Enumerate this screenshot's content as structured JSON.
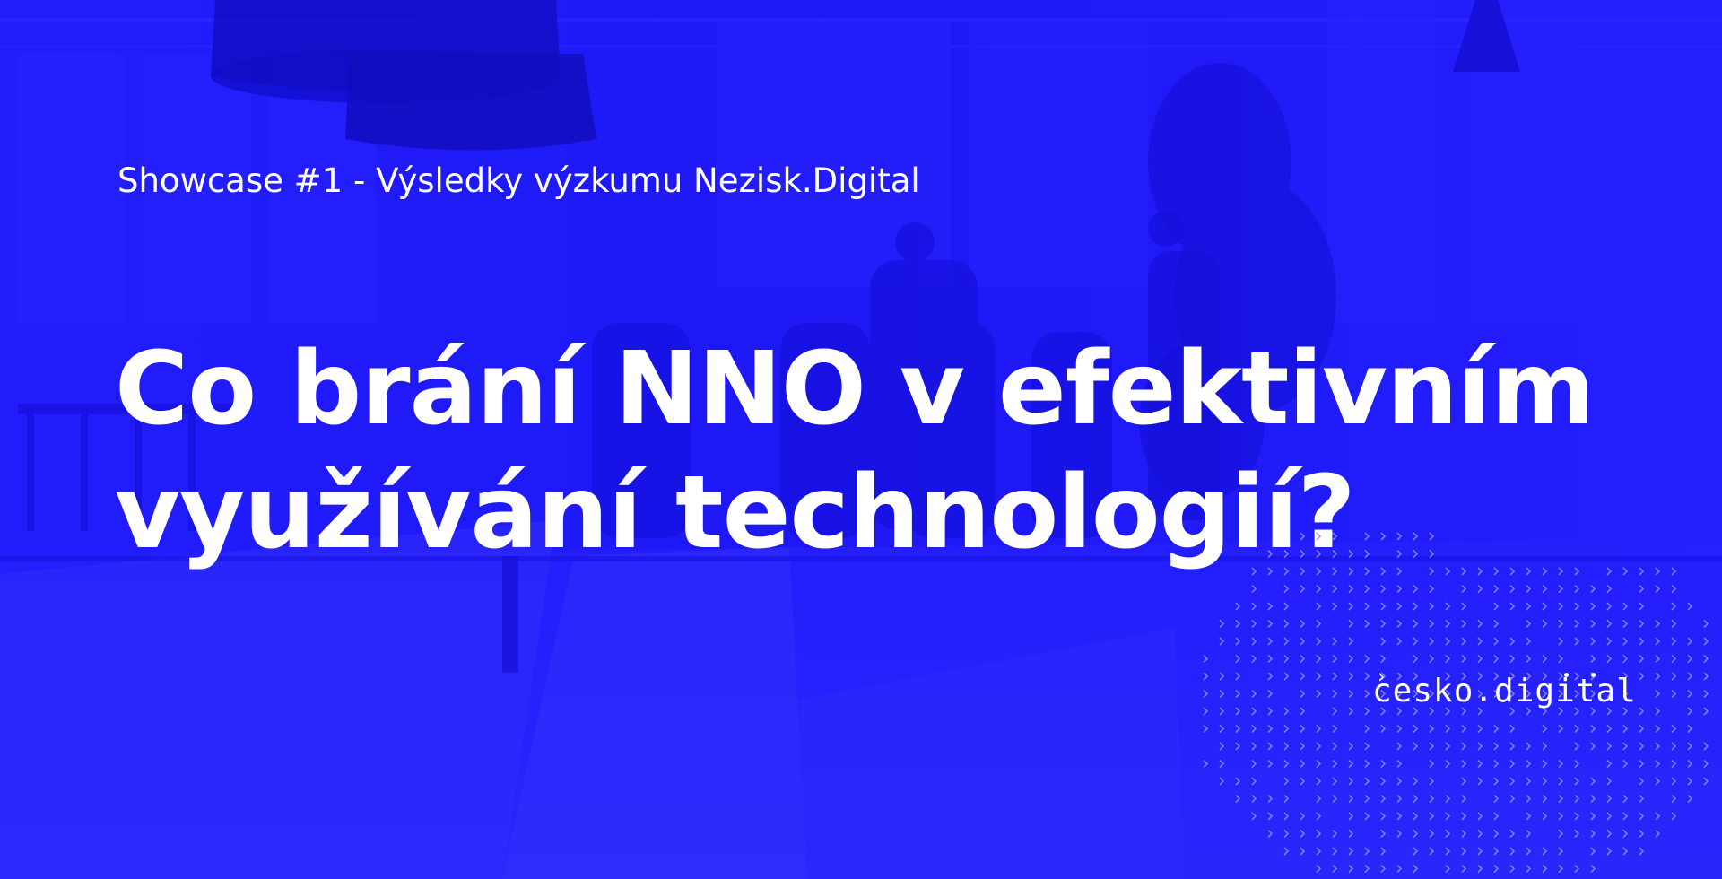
{
  "banner": {
    "subtitle": "Showcase #1 - Výsledky výzkumu Nezisk.Digital",
    "headline_line1": "Co brání NNO v efektivním",
    "headline_line2": "využívání technologií?",
    "logo_text": "cesko.digital",
    "logo_mark_char": "›"
  },
  "colors": {
    "overlay_blue": "#1c18f8",
    "text": "#ffffff"
  },
  "icons": {
    "logo_mark": "chevron-right-icon",
    "decorative_pattern": "chevron-pattern-icon"
  }
}
